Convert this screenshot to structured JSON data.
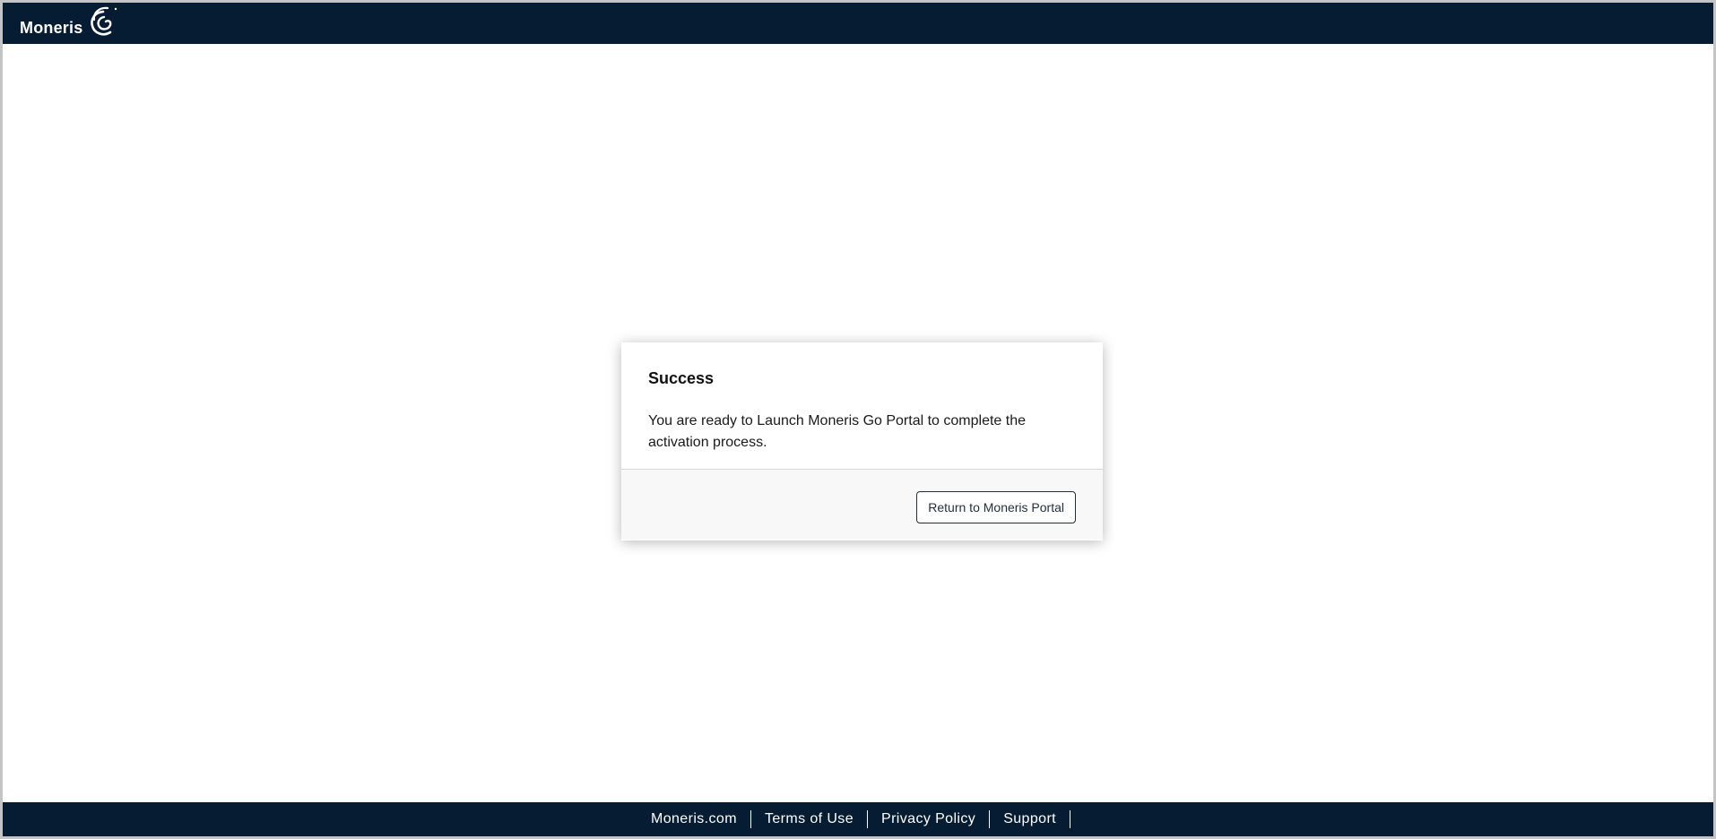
{
  "header": {
    "logo_text": "Moneris",
    "logo_icon": "moneris-swirl-icon",
    "background_color": "#061c33"
  },
  "modal": {
    "title": "Success",
    "message": "You are ready to Launch Moneris Go Portal to complete the activation process.",
    "button_label": "Return to Moneris Portal"
  },
  "footer": {
    "links": [
      "Moneris.com",
      "Terms of Use",
      "Privacy Policy",
      "Support"
    ],
    "background_color": "#061c33"
  }
}
